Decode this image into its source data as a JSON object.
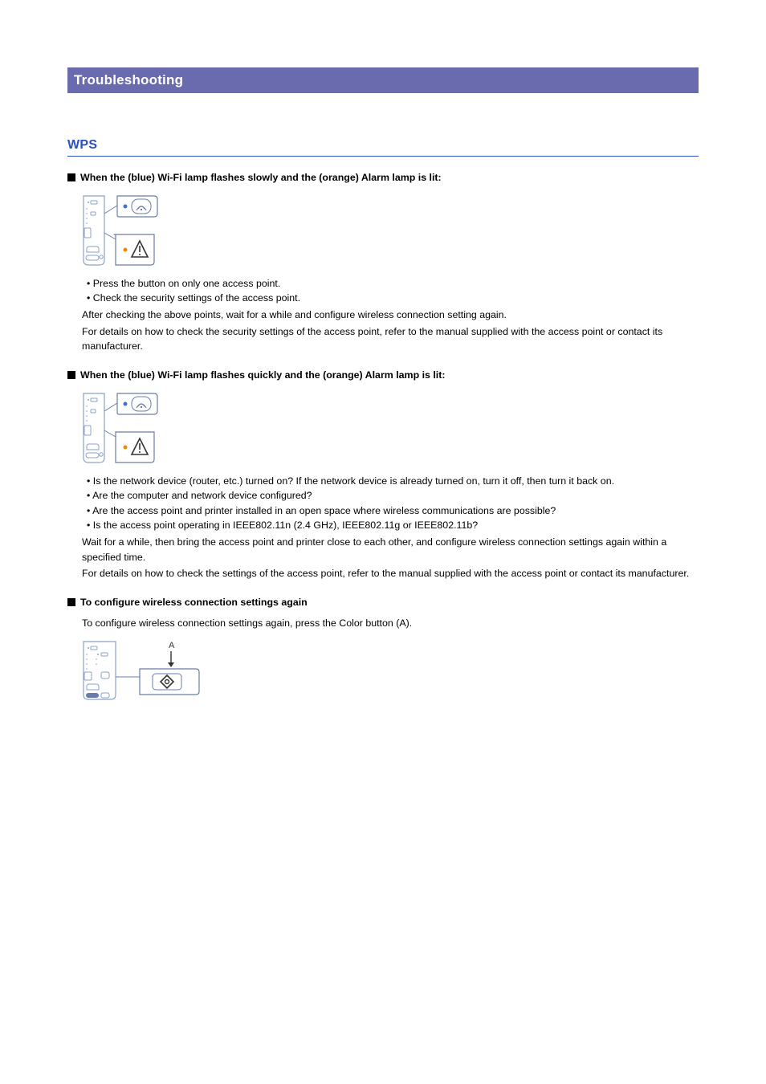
{
  "banner": {
    "title": "Troubleshooting"
  },
  "section": {
    "title": "WPS"
  },
  "sub1": {
    "heading": "When the (blue) Wi-Fi lamp flashes slowly and the (orange) Alarm lamp is lit:",
    "bullets": [
      "Press the button on only one access point.",
      "Check the security settings of the access point."
    ],
    "para1": "After checking the above points, wait for a while and configure wireless connection setting again.",
    "para2": "For details on how to check the security settings of the access point, refer to the manual supplied with the access point or contact its manufacturer."
  },
  "sub2": {
    "heading": "When the (blue) Wi-Fi lamp flashes quickly and the (orange) Alarm lamp is lit:",
    "bullets": [
      "Is the network device (router, etc.) turned on? If the network device is already turned on, turn it off, then turn it back on.",
      "Are the computer and network device configured?",
      "Are the access point and printer installed in an open space where wireless communications are possible?",
      "Is the access point operating in IEEE802.11n (2.4 GHz), IEEE802.11g or IEEE802.11b?"
    ],
    "para1": "Wait for a while, then bring the access point and printer close to each other, and configure wireless connection settings again within a specified time.",
    "para2": "For details on how to check the settings of the access point, refer to the manual supplied with the access point or contact its manufacturer."
  },
  "sub3": {
    "heading": "To configure wireless connection settings again",
    "para1": "To configure wireless connection settings again, press the Color button (A).",
    "label_a": "A"
  }
}
